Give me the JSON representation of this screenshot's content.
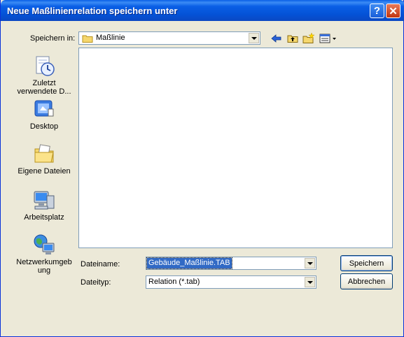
{
  "window": {
    "title": "Neue Maßlinienrelation speichern unter",
    "help_label": "?",
    "close_label": "✕"
  },
  "toolbar": {
    "save_in_label": "Speichern in:",
    "location_value": "Maßlinie",
    "icons": [
      "back-arrow-icon",
      "up-folder-icon",
      "new-folder-icon",
      "view-menu-icon"
    ]
  },
  "places": [
    {
      "label": "Zuletzt verwendete D...",
      "icon": "recent-documents-icon"
    },
    {
      "label": "Desktop",
      "icon": "desktop-icon"
    },
    {
      "label": "Eigene Dateien",
      "icon": "my-documents-icon"
    },
    {
      "label": "Arbeitsplatz",
      "icon": "my-computer-icon"
    },
    {
      "label": "Netzwerkumgebung",
      "icon": "network-icon"
    }
  ],
  "form": {
    "filename_label": "Dateiname:",
    "filename_value": "Gebäude_Maßlinie.TAB",
    "filetype_label": "Dateityp:",
    "filetype_value": "Relation (*.tab)"
  },
  "buttons": {
    "save": "Speichern",
    "cancel": "Abbrechen"
  },
  "colors": {
    "titlebar": "#0a5fe6",
    "dialog_bg": "#ece9d8",
    "selection": "#316ac5"
  }
}
